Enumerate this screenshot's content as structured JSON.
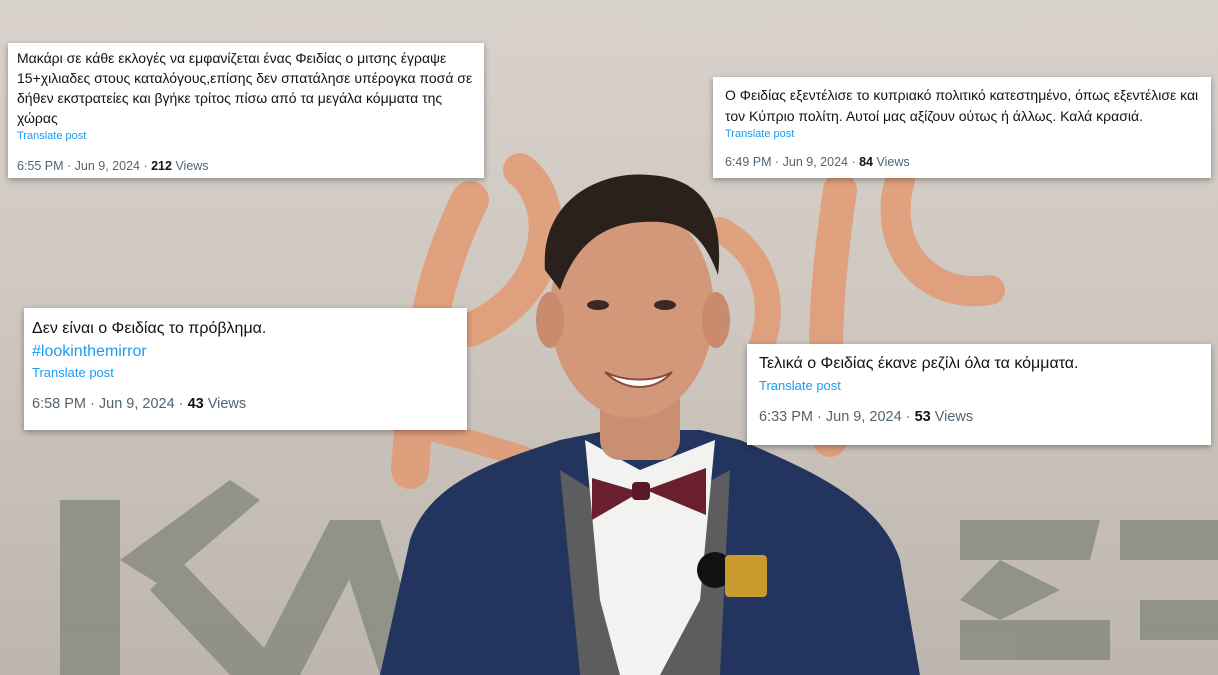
{
  "posts": [
    {
      "text": "Μακάρι σε κάθε εκλογές να εμφανίζεται ένας Φειδίας ο μιτσης έγραψε 15+χιλιαδες στους καταλόγους,επίσης δεν σπατάλησε υπέρογκα ποσά σε δήθεν εκστρατείες και βγήκε τρίτος πίσω από τα μεγάλα κόμματα της χώρας",
      "hashtag": "",
      "translate": "Translate post",
      "time": "6:55 PM · Jun 9, 2024 · ",
      "views_count": "212",
      "views_label": " Views"
    },
    {
      "text": "Ο Φειδίας εξεντέλισε το κυπριακό πολιτικό κατεστημένο, όπως εξεντέλισε και τον Κύπριο πολίτη. Αυτοί μας αξίζουν ούτως ή άλλως. Καλά κρασιά.",
      "hashtag": "",
      "translate": "Translate post",
      "time": "6:49 PM · Jun 9, 2024 · ",
      "views_count": "84",
      "views_label": " Views"
    },
    {
      "text": "Δεν είναι ο Φειδίας το πρόβλημα.",
      "hashtag": "#lookinthemirror",
      "translate": "Translate post",
      "time": "6:58 PM · Jun 9, 2024 · ",
      "views_count": "43",
      "views_label": " Views"
    },
    {
      "text": "Τελικά ο Φειδίας έκανε ρεζίλι όλα τα κόμματα.",
      "hashtag": "",
      "translate": "Translate post",
      "time": "6:33 PM · Jun 9, 2024 · ",
      "views_count": "53",
      "views_label": " Views"
    }
  ],
  "colors": {
    "link": "#1d9bf0",
    "muted": "#536471",
    "text": "#0f1419",
    "backdrop_orange": "#e39a72",
    "backdrop_grey": "#8c8e84",
    "jacket": "#23355e",
    "bowtie": "#6b1f2e"
  }
}
